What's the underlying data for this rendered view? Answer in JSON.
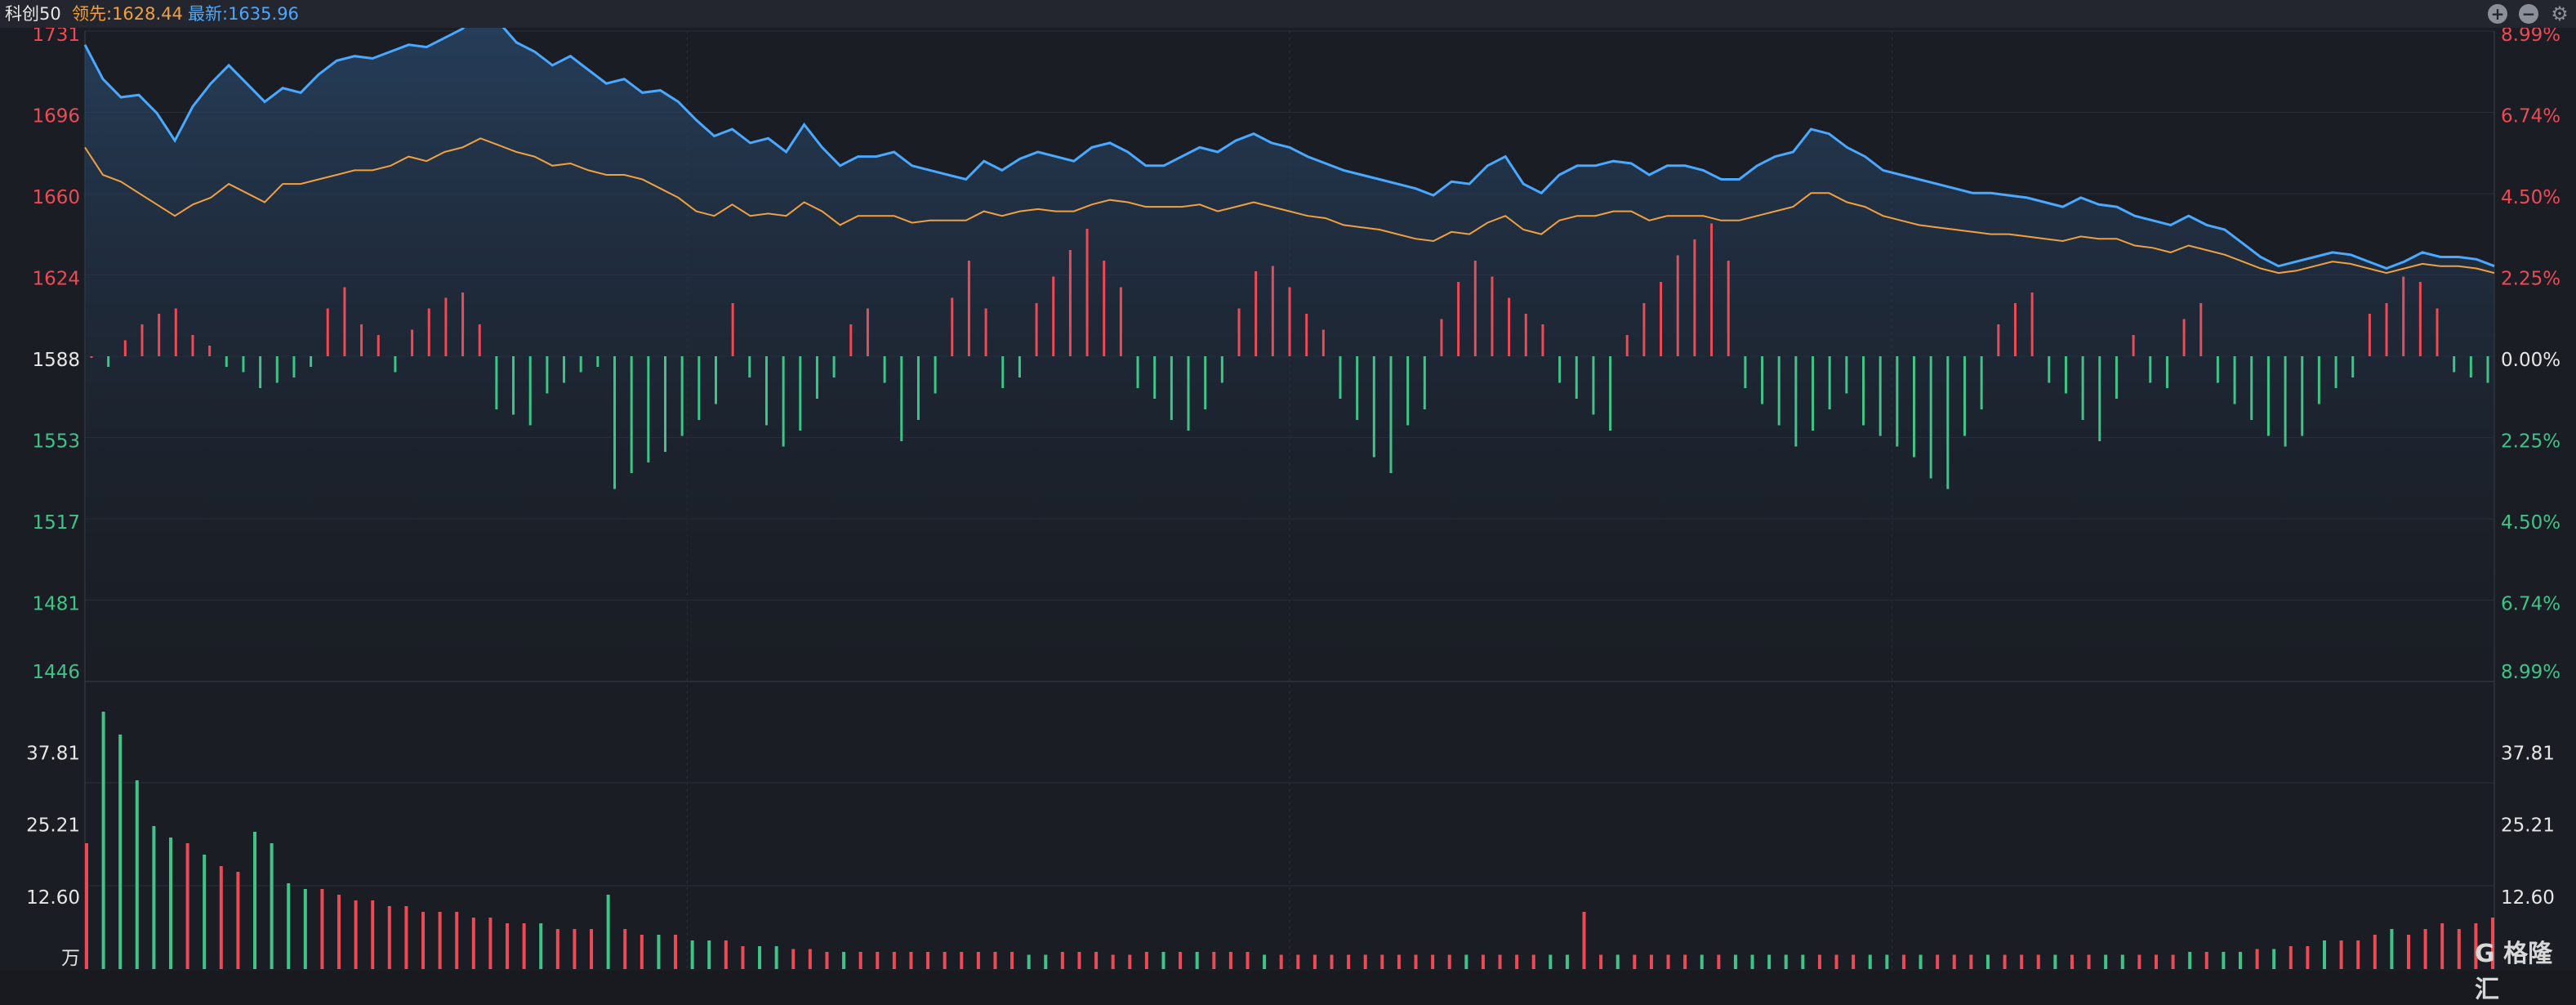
{
  "topbar": {
    "name": "科创50",
    "lead_label": "领先:1628.44",
    "last_label": "最新:1635.96",
    "icons": [
      "plus-circle-icon",
      "minus-circle-icon",
      "gear-icon"
    ]
  },
  "watermark": "G 格隆汇",
  "colors": {
    "up": "#ec4a55",
    "down": "#3ec486",
    "price_line": "#4aa8ff",
    "lead_line": "#f0a040",
    "axis_text_up": "#ec4a55",
    "axis_text_down": "#3ec486",
    "axis_text_neutral": "#e6e6e6"
  },
  "chart_data": [
    {
      "type": "line",
      "title": "",
      "series": [
        {
          "name": "最新",
          "color": "#4aa8ff",
          "values": [
            1725,
            1710,
            1702,
            1703,
            1695,
            1683,
            1698,
            1708,
            1716,
            1708,
            1700,
            1706,
            1704,
            1712,
            1718,
            1720,
            1719,
            1722,
            1725,
            1724,
            1728,
            1732,
            1740,
            1735,
            1726,
            1722,
            1716,
            1720,
            1714,
            1708,
            1710,
            1704,
            1705,
            1700,
            1692,
            1685,
            1688,
            1682,
            1684,
            1678,
            1690,
            1680,
            1672,
            1676,
            1676,
            1678,
            1672,
            1670,
            1668,
            1666,
            1674,
            1670,
            1675,
            1678,
            1676,
            1674,
            1680,
            1682,
            1678,
            1672,
            1672,
            1676,
            1680,
            1678,
            1683,
            1686,
            1682,
            1680,
            1676,
            1673,
            1670,
            1668,
            1666,
            1664,
            1662,
            1659,
            1665,
            1664,
            1672,
            1676,
            1664,
            1660,
            1668,
            1672,
            1672,
            1674,
            1673,
            1668,
            1672,
            1672,
            1670,
            1666,
            1666,
            1672,
            1676,
            1678,
            1688,
            1686,
            1680,
            1676,
            1670,
            1668,
            1666,
            1664,
            1662,
            1660,
            1660,
            1659,
            1658,
            1656,
            1654,
            1658,
            1655,
            1654,
            1650,
            1648,
            1646,
            1650,
            1646,
            1644,
            1638,
            1632,
            1628,
            1630,
            1632,
            1634,
            1633,
            1630,
            1627,
            1630,
            1634,
            1632,
            1632,
            1631,
            1628
          ]
        },
        {
          "name": "领先",
          "color": "#f0a040",
          "values": [
            1680,
            1668,
            1665,
            1660,
            1655,
            1650,
            1655,
            1658,
            1664,
            1660,
            1656,
            1664,
            1664,
            1666,
            1668,
            1670,
            1670,
            1672,
            1676,
            1674,
            1678,
            1680,
            1684,
            1681,
            1678,
            1676,
            1672,
            1673,
            1670,
            1668,
            1668,
            1666,
            1662,
            1658,
            1652,
            1650,
            1655,
            1650,
            1651,
            1650,
            1656,
            1652,
            1646,
            1650,
            1650,
            1650,
            1647,
            1648,
            1648,
            1648,
            1652,
            1650,
            1652,
            1653,
            1652,
            1652,
            1655,
            1657,
            1656,
            1654,
            1654,
            1654,
            1655,
            1652,
            1654,
            1656,
            1654,
            1652,
            1650,
            1649,
            1646,
            1645,
            1644,
            1642,
            1640,
            1639,
            1643,
            1642,
            1647,
            1650,
            1644,
            1642,
            1648,
            1650,
            1650,
            1652,
            1652,
            1648,
            1650,
            1650,
            1650,
            1648,
            1648,
            1650,
            1652,
            1654,
            1660,
            1660,
            1656,
            1654,
            1650,
            1648,
            1646,
            1645,
            1644,
            1643,
            1642,
            1642,
            1641,
            1640,
            1639,
            1641,
            1640,
            1640,
            1637,
            1636,
            1634,
            1637,
            1635,
            1633,
            1630,
            1627,
            1625,
            1626,
            1628,
            1630,
            1629,
            1627,
            1625,
            1627,
            1629,
            1628,
            1628,
            1627,
            1625
          ]
        }
      ],
      "ylim": [
        1446,
        1731
      ],
      "y_ticks": [
        "1731",
        "1696",
        "1660",
        "1624",
        "1588",
        "1553",
        "1517",
        "1481",
        "1446"
      ],
      "y_ticks_right": [
        "8.99%",
        "6.74%",
        "4.50%",
        "2.25%",
        "0.00%",
        "2.25%",
        "4.50%",
        "6.74%",
        "8.99%"
      ],
      "grid": true
    },
    {
      "type": "bar",
      "title": "",
      "unit": "万",
      "y_ticks": [
        "37.81",
        "25.21",
        "12.60"
      ],
      "ylim": [
        0,
        50
      ],
      "values": [
        22,
        45,
        41,
        33,
        25,
        23,
        22,
        20,
        18,
        17,
        24,
        22,
        15,
        14,
        14,
        13,
        12,
        12,
        11,
        11,
        10,
        10,
        10,
        9,
        9,
        8,
        8,
        8,
        7,
        7,
        7,
        13,
        7,
        6,
        6,
        6,
        5,
        5,
        5,
        4,
        4,
        4,
        3.5,
        3.5,
        3,
        3,
        3,
        3,
        3,
        3,
        3,
        3,
        3,
        3,
        3,
        3,
        2.5,
        2.5,
        3,
        3,
        3,
        2.5,
        2.5,
        3,
        3,
        3,
        3,
        3,
        3,
        3,
        2.5,
        2.5,
        2.5,
        2.5,
        2.5,
        2.5,
        2.5,
        2.5,
        2.5,
        2.5,
        2.5,
        2.5,
        2.5,
        2.5,
        2.5,
        2.5,
        2.5,
        2.5,
        2.5,
        10,
        2.5,
        2.5,
        2.5,
        2.5,
        2.5,
        2.5,
        2.5,
        2.5,
        2.5,
        2.5,
        2.5,
        2.5,
        2.5,
        2.5,
        2.5,
        2.5,
        2.5,
        2.5,
        2.5,
        2.5,
        2.5,
        2.5,
        2.5,
        2.5,
        2.5,
        2.5,
        2.5,
        2.5,
        2.5,
        2.5,
        2.5,
        2.5,
        2.5,
        2.5,
        2.5,
        3,
        3,
        3,
        3,
        3.5,
        3.5,
        4,
        4,
        5,
        5,
        5,
        6,
        7,
        6,
        7,
        8,
        7,
        8,
        9
      ],
      "directions": [
        "up",
        "down",
        "down",
        "down",
        "down",
        "down",
        "up",
        "down",
        "up",
        "up",
        "down",
        "down",
        "down",
        "down",
        "up",
        "up",
        "up",
        "up",
        "up",
        "up",
        "up",
        "up",
        "up",
        "up",
        "up",
        "up",
        "up",
        "down",
        "up",
        "up",
        "up",
        "down",
        "up",
        "up",
        "down",
        "up",
        "down",
        "down",
        "up",
        "up",
        "down",
        "down",
        "up",
        "up",
        "up",
        "down",
        "up",
        "up",
        "up",
        "up",
        "up",
        "up",
        "up",
        "up",
        "up",
        "up",
        "down",
        "down",
        "up",
        "up",
        "up",
        "up",
        "up",
        "up",
        "down",
        "up",
        "down",
        "up",
        "up",
        "up",
        "down",
        "up",
        "up",
        "up",
        "up",
        "up",
        "up",
        "up",
        "up",
        "up",
        "up",
        "up",
        "down",
        "up",
        "up",
        "up",
        "up",
        "down",
        "down",
        "up",
        "up",
        "down",
        "up",
        "up",
        "up",
        "up",
        "down",
        "up",
        "down",
        "down",
        "down",
        "down",
        "down",
        "up",
        "up",
        "up",
        "down",
        "down",
        "up",
        "down",
        "up",
        "up",
        "up",
        "down",
        "up",
        "up",
        "up",
        "down",
        "up",
        "up",
        "down",
        "down",
        "up",
        "up",
        "up",
        "down",
        "up",
        "down",
        "down",
        "up",
        "down",
        "up",
        "up",
        "down",
        "up",
        "up",
        "up",
        "down",
        "up",
        "up",
        "up"
      ]
    },
    {
      "type": "bar",
      "title": "",
      "subtitle": "",
      "values": [
        0,
        -0.2,
        0.3,
        0.6,
        0.8,
        0.9,
        0.4,
        0.2,
        -0.2,
        -0.3,
        -0.6,
        -0.5,
        -0.4,
        -0.2,
        0.9,
        1.3,
        0.6,
        0.4,
        -0.3,
        0.5,
        0.9,
        1.1,
        1.2,
        0.6,
        -1.0,
        -1.1,
        -1.3,
        -0.7,
        -0.5,
        -0.3,
        -0.2,
        -2.5,
        -2.2,
        -2.0,
        -1.8,
        -1.5,
        -1.2,
        -0.9,
        1.0,
        -0.4,
        -1.3,
        -1.7,
        -1.4,
        -0.8,
        -0.4,
        0.6,
        0.9,
        -0.5,
        -1.6,
        -1.2,
        -0.7,
        1.1,
        1.8,
        0.9,
        -0.6,
        -0.4,
        1.0,
        1.5,
        2.0,
        2.4,
        1.8,
        1.3,
        -0.6,
        -0.8,
        -1.2,
        -1.4,
        -1.0,
        -0.5,
        0.9,
        1.6,
        1.7,
        1.3,
        0.8,
        0.5,
        -0.8,
        -1.2,
        -1.9,
        -2.2,
        -1.3,
        -1.0,
        0.7,
        1.4,
        1.8,
        1.5,
        1.1,
        0.8,
        0.6,
        -0.5,
        -0.8,
        -1.1,
        -1.4,
        0.4,
        1.0,
        1.4,
        1.9,
        2.2,
        2.5,
        1.8,
        -0.6,
        -0.9,
        -1.3,
        -1.7,
        -1.4,
        -1.0,
        -0.7,
        -1.3,
        -1.5,
        -1.7,
        -1.9,
        -2.3,
        -2.5,
        -1.5,
        -1.0,
        0.6,
        1.0,
        1.2,
        -0.5,
        -0.7,
        -1.2,
        -1.6,
        -0.8,
        0.4,
        -0.5,
        -0.6,
        0.7,
        1.0,
        -0.5,
        -0.9,
        -1.2,
        -1.5,
        -1.7,
        -1.5,
        -0.9,
        -0.6,
        -0.4,
        0.8,
        1.0,
        1.5,
        1.4,
        0.9,
        -0.3,
        -0.4,
        -0.5
      ]
    }
  ]
}
